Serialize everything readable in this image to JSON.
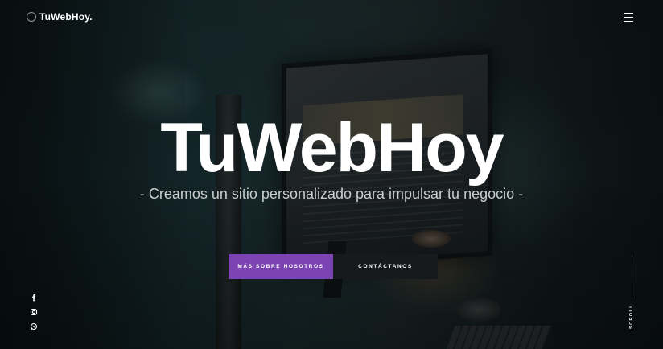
{
  "header": {
    "logo_text": "TuWebHoy.",
    "menu_icon": "hamburger-menu-icon"
  },
  "hero": {
    "title": "TuWebHoy",
    "subtitle": "- Creamos un sitio personalizado para impulsar tu negocio -",
    "primary_button": "Más sobre nosotros",
    "secondary_button": "Contáctanos"
  },
  "social": {
    "icons": [
      "facebook-icon",
      "instagram-icon",
      "whatsapp-icon"
    ]
  },
  "scroll": {
    "label": "SCROLL"
  },
  "colors": {
    "accent": "#7b44b2",
    "secondary_button": "#171a1c",
    "text": "#ffffff"
  }
}
